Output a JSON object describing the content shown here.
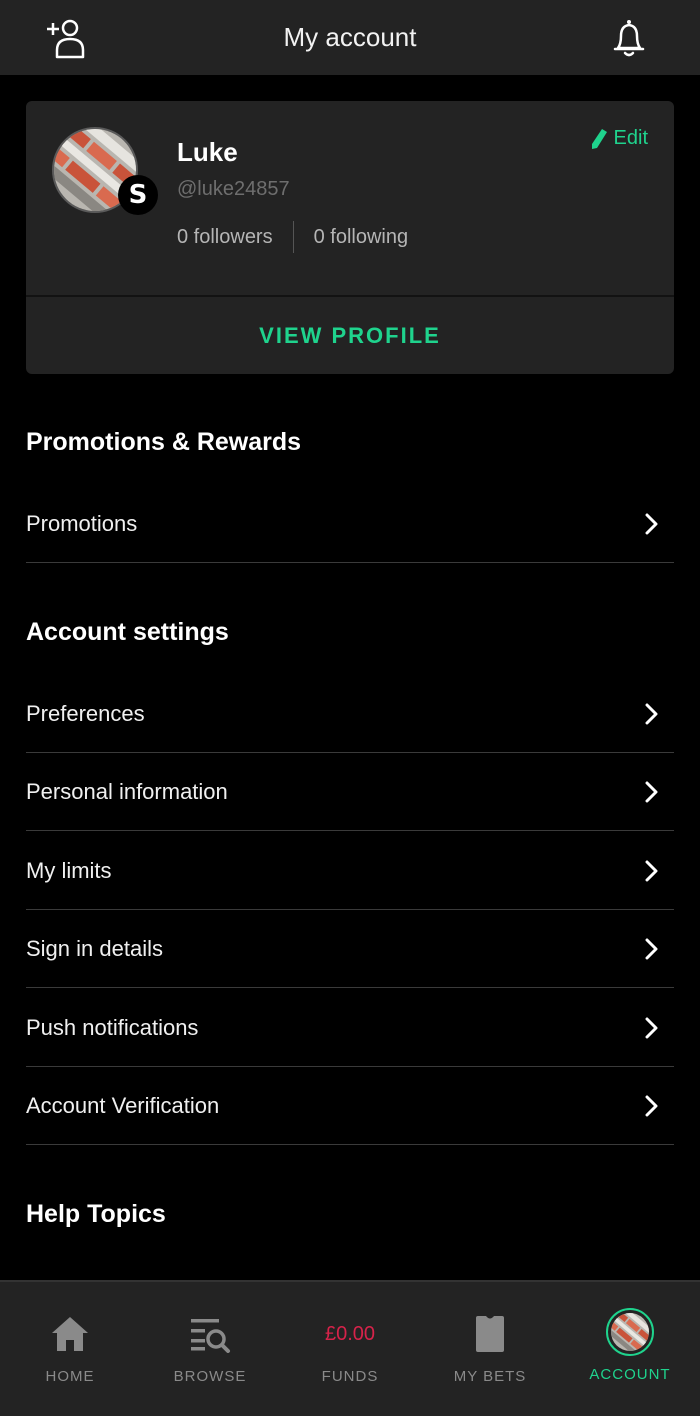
{
  "header": {
    "title": "My account",
    "add_friend_icon": "add-user-icon",
    "notifications_icon": "bell-icon"
  },
  "profile": {
    "name": "Luke",
    "handle": "@luke24857",
    "followers": "0 followers",
    "following": "0 following",
    "edit_label": "Edit",
    "view_profile_label": "VIEW PROFILE",
    "badge_letter": "S"
  },
  "sections": {
    "promotions_title": "Promotions & Rewards",
    "promotions_items": [
      "Promotions"
    ],
    "account_settings_title": "Account settings",
    "account_settings_items": [
      "Preferences",
      "Personal information",
      "My limits",
      "Sign in details",
      "Push notifications",
      "Account Verification"
    ],
    "help_title": "Help Topics"
  },
  "bottom_nav": {
    "items": [
      {
        "label": "HOME",
        "icon": "home-icon"
      },
      {
        "label": "BROWSE",
        "icon": "browse-icon"
      },
      {
        "label": "FUNDS",
        "amount": "£0.00"
      },
      {
        "label": "MY BETS",
        "icon": "bet-slip-icon"
      },
      {
        "label": "ACCOUNT",
        "icon": "avatar"
      }
    ],
    "active": "ACCOUNT"
  },
  "colors": {
    "accent": "#1fd38d",
    "funds": "#d6234a",
    "surface": "#232323",
    "background": "#000000"
  }
}
